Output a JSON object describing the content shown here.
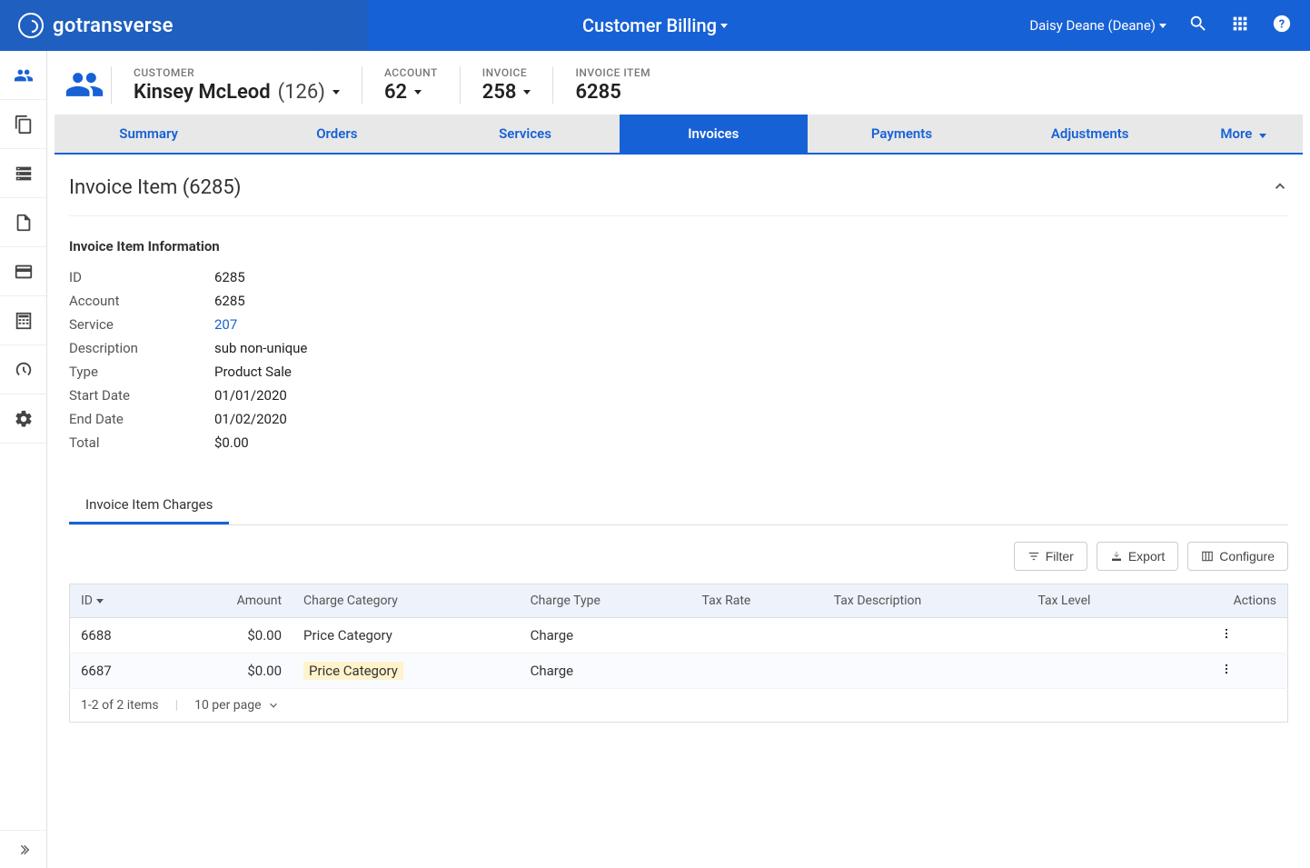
{
  "brand": "gotransverse",
  "header": {
    "center_title": "Customer Billing",
    "user_display": "Daisy Deane (Deane)"
  },
  "context": {
    "customer_label": "CUSTOMER",
    "customer_name": "Kinsey McLeod",
    "customer_id_suffix": "(126)",
    "account_label": "ACCOUNT",
    "account_value": "62",
    "invoice_label": "INVOICE",
    "invoice_value": "258",
    "invoice_item_label": "INVOICE ITEM",
    "invoice_item_value": "6285"
  },
  "tabs": {
    "summary": "Summary",
    "orders": "Orders",
    "services": "Services",
    "invoices": "Invoices",
    "payments": "Payments",
    "adjustments": "Adjustments",
    "more": "More"
  },
  "section": {
    "title": "Invoice Item (6285)",
    "info_heading": "Invoice Item Information",
    "fields": {
      "id_label": "ID",
      "id_value": "6285",
      "account_label": "Account",
      "account_value": "6285",
      "service_label": "Service",
      "service_value": "207",
      "description_label": "Description",
      "description_value": "sub non-unique",
      "type_label": "Type",
      "type_value": "Product Sale",
      "start_label": "Start Date",
      "start_value": "01/01/2020",
      "end_label": "End Date",
      "end_value": "01/02/2020",
      "total_label": "Total",
      "total_value": "$0.00"
    }
  },
  "subtab": "Invoice Item Charges",
  "toolbar": {
    "filter": "Filter",
    "export": "Export",
    "configure": "Configure"
  },
  "table": {
    "columns": {
      "id": "ID",
      "amount": "Amount",
      "charge_category": "Charge Category",
      "charge_type": "Charge Type",
      "tax_rate": "Tax Rate",
      "tax_description": "Tax Description",
      "tax_level": "Tax Level",
      "actions": "Actions"
    },
    "rows": [
      {
        "id": "6688",
        "amount": "$0.00",
        "charge_category": "Price Category",
        "charge_type": "Charge",
        "tax_rate": "",
        "tax_description": "",
        "tax_level": "",
        "highlight": false
      },
      {
        "id": "6687",
        "amount": "$0.00",
        "charge_category": "Price Category",
        "charge_type": "Charge",
        "tax_rate": "",
        "tax_description": "",
        "tax_level": "",
        "highlight": true
      }
    ],
    "footer_count": "1-2 of 2 items",
    "per_page": "10 per page"
  }
}
